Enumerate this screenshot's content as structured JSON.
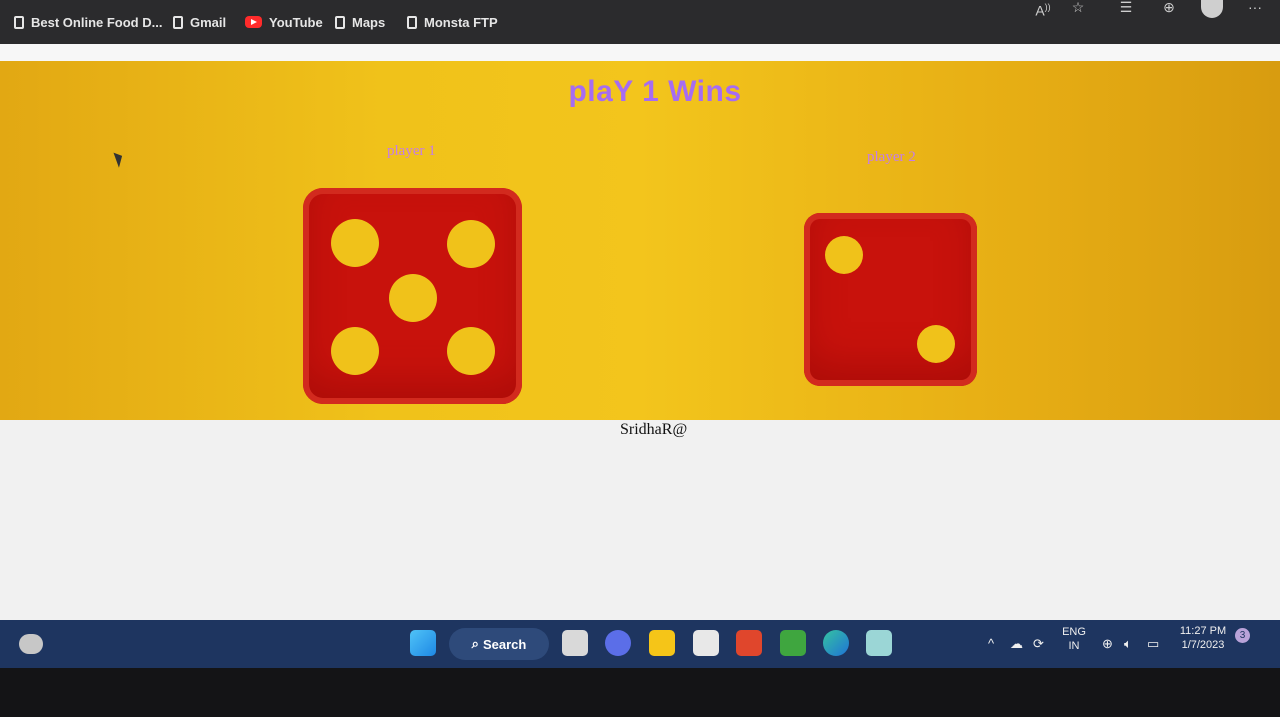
{
  "bookmarks": [
    {
      "label": "Best Online Food D...",
      "icon": "page-icon"
    },
    {
      "label": "Gmail",
      "icon": "page-icon"
    },
    {
      "label": "YouTube",
      "icon": "youtube-icon"
    },
    {
      "label": "Maps",
      "icon": "page-icon"
    },
    {
      "label": "Monsta FTP",
      "icon": "page-icon"
    }
  ],
  "toolbar": {
    "more_label": "···"
  },
  "game": {
    "result": "plaY 1 Wins",
    "player1_label": "player 1",
    "player2_label": "player 2",
    "player1_roll": 5,
    "player2_roll": 2,
    "credit": "SridhaR@"
  },
  "colors": {
    "die": "#c8120c",
    "pip": "#f0c21a",
    "title": "#a66cf2",
    "player_label": "#c57de8"
  },
  "taskbar": {
    "search_label": "Search",
    "language_line1": "ENG",
    "language_line2": "IN",
    "time": "11:27 PM",
    "date": "1/7/2023",
    "notification_count": "3"
  }
}
